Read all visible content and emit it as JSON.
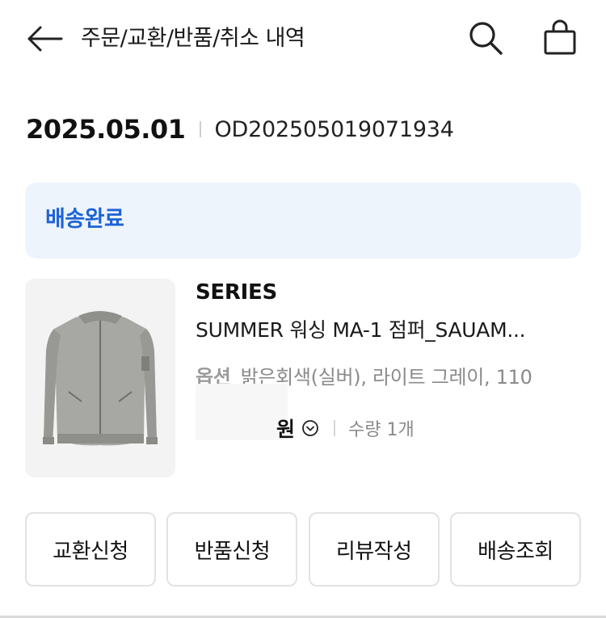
{
  "header": {
    "title": "주문/교환/반품/취소 내역",
    "back_icon": "arrow-left-icon",
    "search_icon": "search-icon",
    "cart_icon": "shopping-bag-icon"
  },
  "order": {
    "date": "2025.05.01",
    "number": "OD202505019071934"
  },
  "status": {
    "label": "배송완료",
    "color": "#1e63d6",
    "background": "#eef4fc"
  },
  "product": {
    "brand": "SERIES",
    "name": "SUMMER 워싱 MA-1 점퍼_SAUAM...",
    "option_label": "옵션",
    "option_value": "밝은회색(실버), 라이트 그레이, 110",
    "price": "원",
    "quantity": "수량 1개"
  },
  "actions": [
    {
      "label": "교환신청"
    },
    {
      "label": "반품신청"
    },
    {
      "label": "리뷰작성"
    },
    {
      "label": "배송조회"
    }
  ]
}
